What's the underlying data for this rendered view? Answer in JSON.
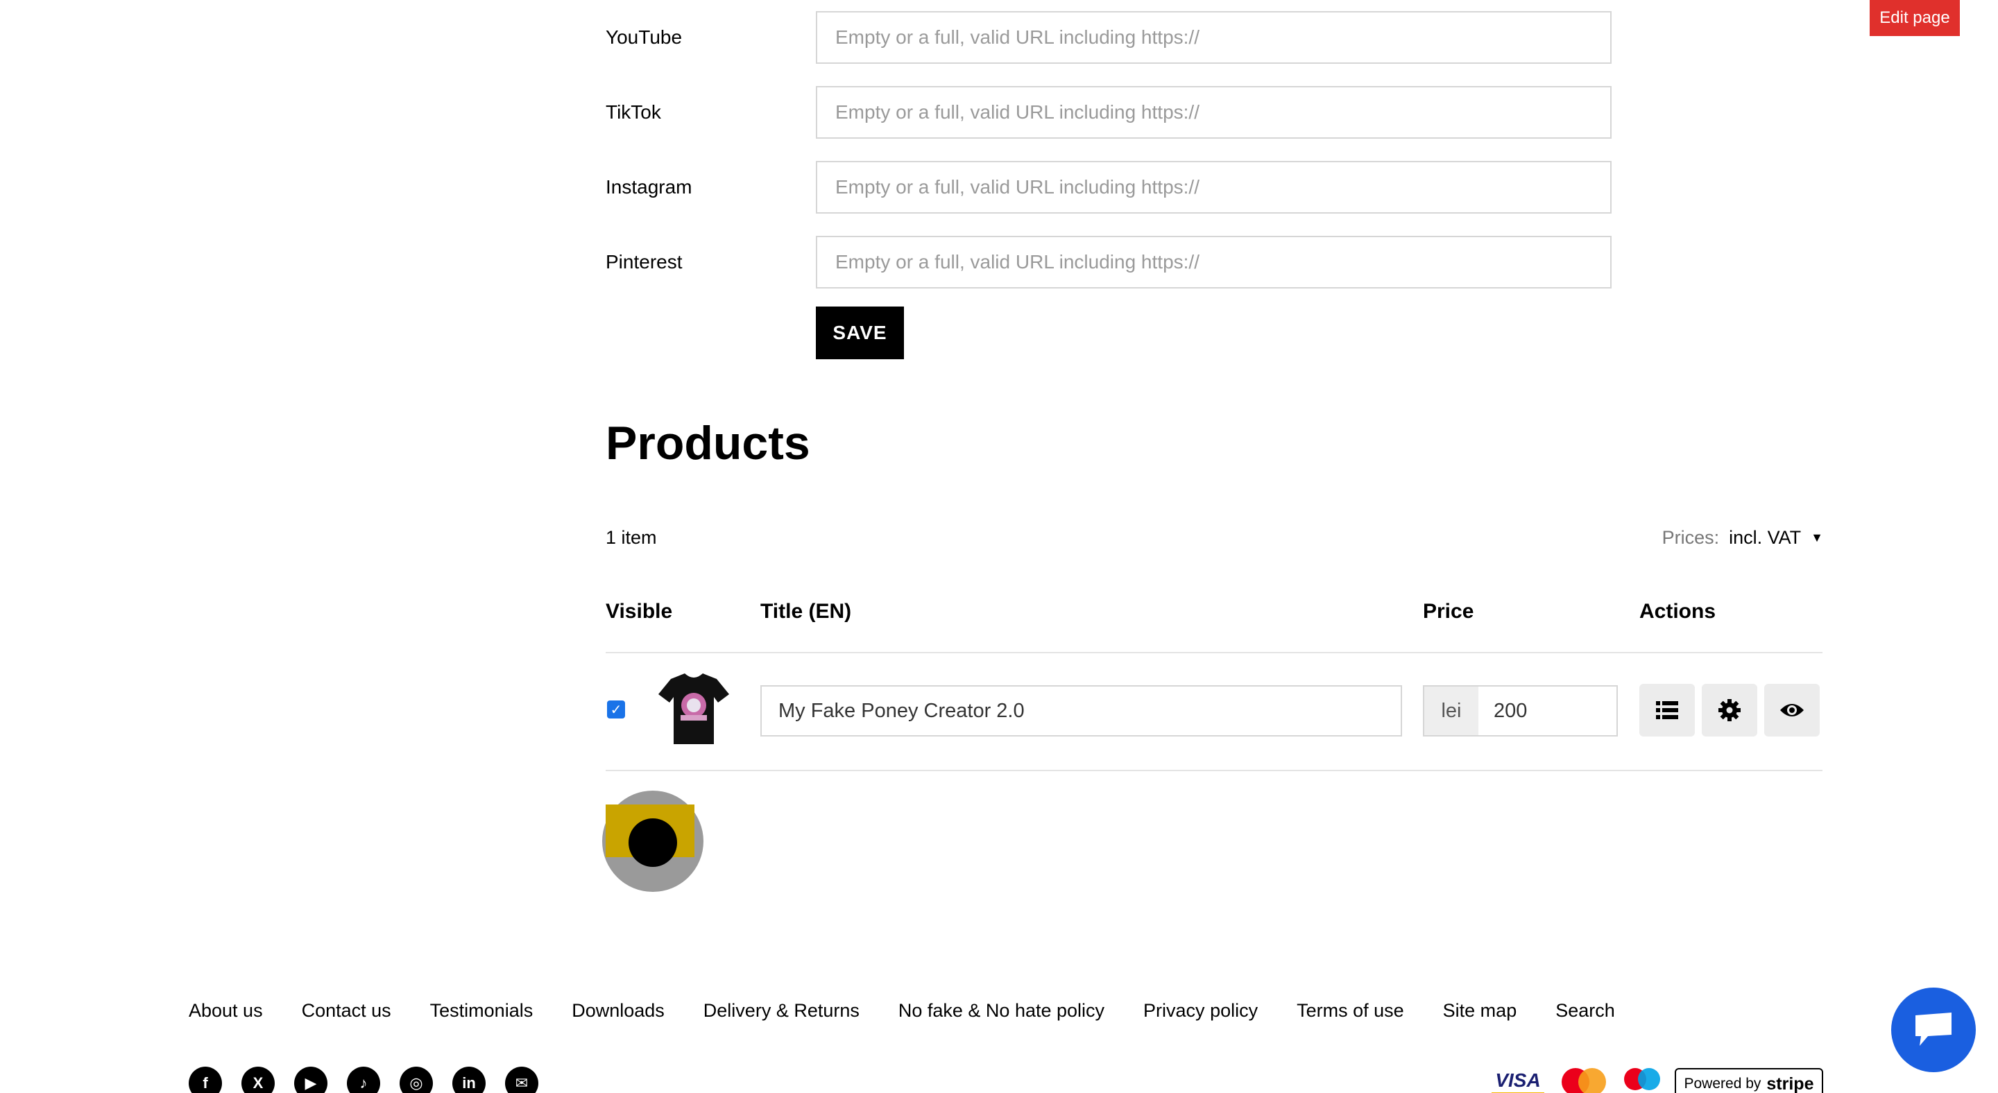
{
  "top_bar": {
    "edit_page_label": "Edit page"
  },
  "social_links": {
    "placeholder": "Empty or a full, valid URL including https://",
    "rows": [
      {
        "label": "YouTube",
        "value": ""
      },
      {
        "label": "TikTok",
        "value": ""
      },
      {
        "label": "Instagram",
        "value": ""
      },
      {
        "label": "Pinterest",
        "value": ""
      }
    ],
    "save_label": "SAVE"
  },
  "products": {
    "title": "Products",
    "count": "1 item",
    "prices_label": "Prices:",
    "prices_value": "incl. VAT",
    "columns": {
      "visible": "Visible",
      "title": "Title (EN)",
      "price": "Price",
      "actions": "Actions"
    },
    "rows": [
      {
        "visible": true,
        "title": "My Fake Poney Creator 2.0",
        "currency": "lei",
        "price": "200",
        "thumbnail_icon": "tshirt-thumbnail",
        "actions": [
          "list-icon",
          "gear-icon",
          "eye-icon"
        ]
      }
    ]
  },
  "footer": {
    "links": [
      "About us",
      "Contact us",
      "Testimonials",
      "Downloads",
      "Delivery & Returns",
      "No fake & No hate policy",
      "Privacy policy",
      "Terms of use",
      "Site map",
      "Search"
    ],
    "social_icons": [
      "facebook-icon",
      "x-icon",
      "youtube-icon",
      "tiktok-icon",
      "instagram-icon",
      "linkedin-icon",
      "email-icon"
    ],
    "payments": {
      "visa": "VISA",
      "powered_by": "Powered by",
      "stripe": "stripe"
    }
  },
  "colors": {
    "accent_red": "#e0302c",
    "chat_blue": "#1a5fe0",
    "checkbox_blue": "#1a73e8"
  }
}
